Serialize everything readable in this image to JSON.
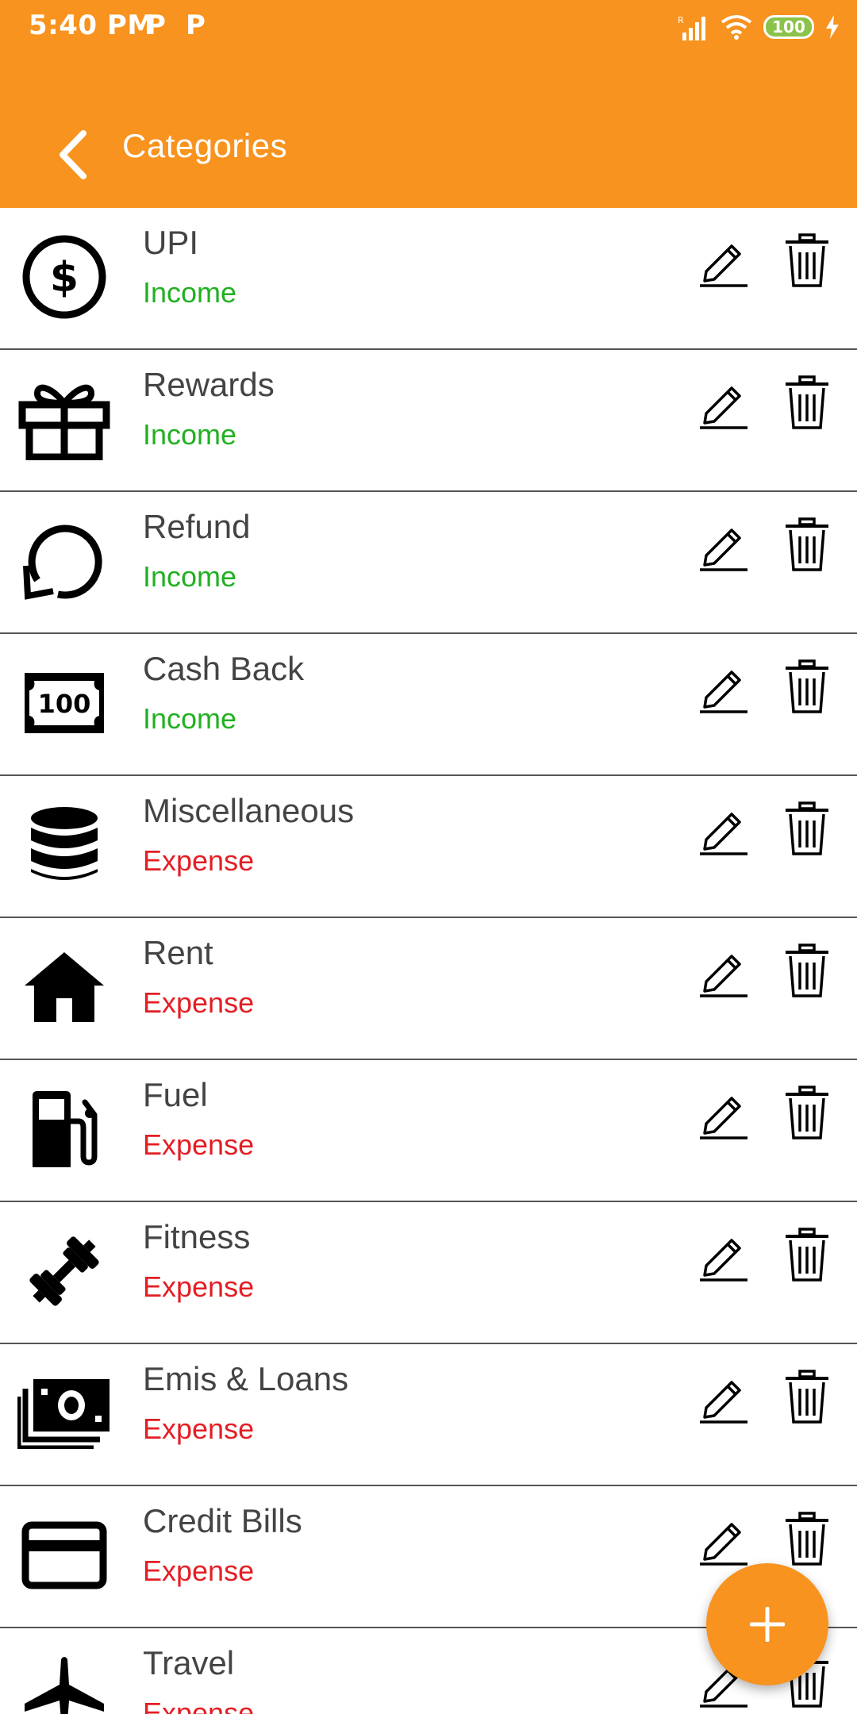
{
  "status_bar": {
    "time": "5:40 PM",
    "notif_1": "P",
    "notif_2": "P",
    "battery": "100"
  },
  "toolbar": {
    "title": "Categories"
  },
  "colors": {
    "accent": "#F7931E",
    "income": "#22B022",
    "expense": "#E31E24",
    "text": "#444444"
  },
  "categories": [
    {
      "name": "UPI",
      "type": "Income",
      "icon": "dollar-circle-icon"
    },
    {
      "name": "Rewards",
      "type": "Income",
      "icon": "gift-icon"
    },
    {
      "name": "Refund",
      "type": "Income",
      "icon": "refresh-icon"
    },
    {
      "name": "Cash Back",
      "type": "Income",
      "icon": "banknote-100-icon"
    },
    {
      "name": "Miscellaneous",
      "type": "Expense",
      "icon": "database-icon"
    },
    {
      "name": "Rent",
      "type": "Expense",
      "icon": "home-icon"
    },
    {
      "name": "Fuel",
      "type": "Expense",
      "icon": "fuel-pump-icon"
    },
    {
      "name": "Fitness",
      "type": "Expense",
      "icon": "dumbbell-icon"
    },
    {
      "name": "Emis & Loans",
      "type": "Expense",
      "icon": "money-stack-icon"
    },
    {
      "name": "Credit Bills",
      "type": "Expense",
      "icon": "credit-card-icon"
    },
    {
      "name": "Travel",
      "type": "Expense",
      "icon": "airplane-icon"
    }
  ]
}
